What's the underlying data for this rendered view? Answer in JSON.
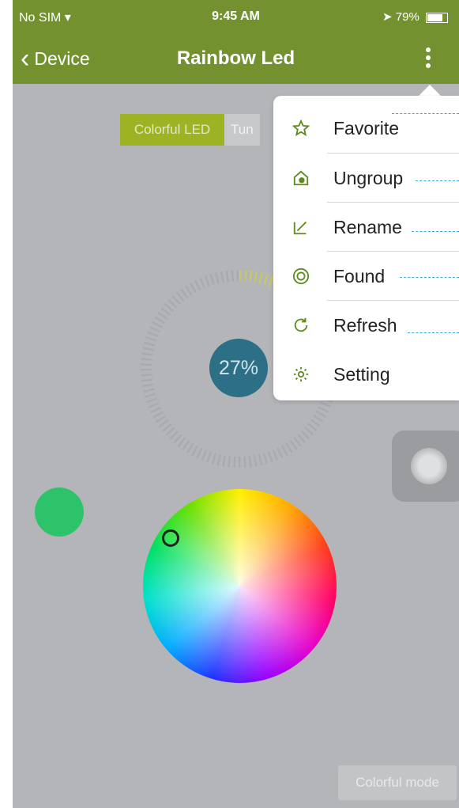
{
  "status_bar": {
    "carrier": "No SIM",
    "time": "9:45 AM",
    "battery": "79%"
  },
  "nav": {
    "back_label": "Device",
    "title": "Rainbow Led"
  },
  "tabs": {
    "active": "Colorful LED",
    "inactive": "Tun"
  },
  "brightness": {
    "label": "27%",
    "value": 27
  },
  "mode_button": "Colorful mode",
  "menu": {
    "items": [
      {
        "label": "Favorite",
        "icon": "star-icon"
      },
      {
        "label": "Ungroup",
        "icon": "ungroup-icon"
      },
      {
        "label": "Rename",
        "icon": "edit-icon"
      },
      {
        "label": "Found",
        "icon": "found-icon"
      },
      {
        "label": "Refresh",
        "icon": "refresh-icon"
      },
      {
        "label": "Setting",
        "icon": "gear-icon"
      }
    ]
  },
  "colors": {
    "bar": "#73922f",
    "accent": "#9eb324",
    "selected_color": "#2dc36a",
    "knob": "#2d6f86"
  }
}
